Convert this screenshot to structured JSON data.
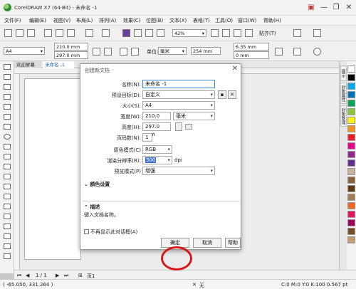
{
  "window": {
    "title": "CorelDRAW X7 (64-Bit) - 未命名 -1",
    "buttons": [
      "▣",
      "—",
      "❐",
      "✕"
    ]
  },
  "menu": [
    "文件(F)",
    "编辑(E)",
    "视图(V)",
    "布局(L)",
    "排列(A)",
    "效果(C)",
    "位图(B)",
    "文本(X)",
    "表格(T)",
    "工具(O)",
    "窗口(W)",
    "帮助(H)"
  ],
  "toolbar1": {
    "zoom": "42%",
    "snap": "贴齐(T)"
  },
  "toolbar2": {
    "page_size": "A4",
    "width": "210.0 mm",
    "height": "297.0 mm",
    "unit_label": "单位:",
    "unit": "毫米",
    "nudge": "254 mm",
    "dup_x": "6.35 mm",
    "dup_y": "0 mm"
  },
  "doc_tabs": [
    "欢迎屏幕",
    "未命名 -1"
  ],
  "right_tabs": [
    "提示",
    "对象属性",
    "对象管理器"
  ],
  "palette": [
    "#ffffff",
    "#000000",
    "#00aeef",
    "#0072bc",
    "#00a651",
    "#8dc63f",
    "#fff200",
    "#f7941d",
    "#ed1c24",
    "#ec008c",
    "#92278f",
    "#662d91",
    "#c7b299",
    "#8c6239",
    "#603913",
    "#a67c52",
    "#f26522",
    "#ed145b",
    "#9e005d",
    "#754c24",
    "#c69c6d"
  ],
  "bottom_nav": {
    "page_count": "1 / 1",
    "page_tab": "页1"
  },
  "status": {
    "coords": "( -65.050, 331.264 )",
    "fill_none": "无",
    "cmyk": "C:0 M:0 Y:0 K:100 0.567 pt",
    "hint": "C: 0 M: 0 Y: 0 K: 100"
  },
  "dialog": {
    "title": "创建新文档",
    "name_label": "名称(N):",
    "name_value": "未命名 -1",
    "preset_label": "预设目标(D):",
    "preset_value": "自定义",
    "size_label": "大小(S):",
    "size_value": "A4",
    "width_label": "宽度(W):",
    "width_value": "210.0 mm",
    "width_unit": "毫米",
    "height_label": "高度(H):",
    "height_value": "297.0 mm",
    "pages_label": "页码数(N):",
    "pages_value": "1",
    "color_mode_label": "原色模式(C)",
    "color_mode_value": "RGB",
    "resolution_label": "渲染分辨率(R):",
    "resolution_value": "300",
    "resolution_unit": "dpi",
    "preview_label": "预览模式(P)",
    "preview_value": "增强",
    "color_settings": "颜色设置",
    "description_header": "描述",
    "description_text": "键入文档名称。",
    "no_show_label": "不再显示此对话框(A)",
    "ok": "确定",
    "cancel": "取消",
    "help": "帮助"
  }
}
